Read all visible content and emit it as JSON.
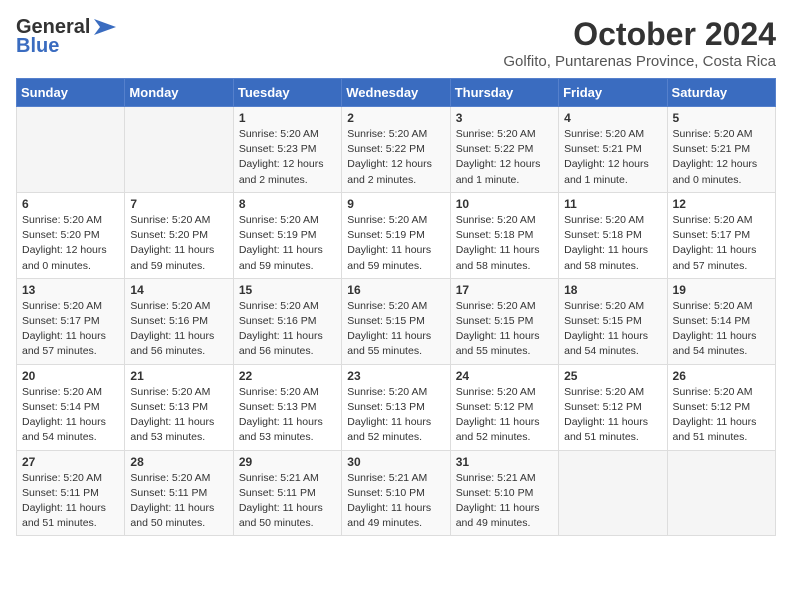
{
  "header": {
    "logo_line1": "General",
    "logo_line2": "Blue",
    "main_title": "October 2024",
    "subtitle": "Golfito, Puntarenas Province, Costa Rica"
  },
  "calendar": {
    "days_of_week": [
      "Sunday",
      "Monday",
      "Tuesday",
      "Wednesday",
      "Thursday",
      "Friday",
      "Saturday"
    ],
    "weeks": [
      [
        {
          "day": "",
          "info": ""
        },
        {
          "day": "",
          "info": ""
        },
        {
          "day": "1",
          "info": "Sunrise: 5:20 AM\nSunset: 5:23 PM\nDaylight: 12 hours\nand 2 minutes."
        },
        {
          "day": "2",
          "info": "Sunrise: 5:20 AM\nSunset: 5:22 PM\nDaylight: 12 hours\nand 2 minutes."
        },
        {
          "day": "3",
          "info": "Sunrise: 5:20 AM\nSunset: 5:22 PM\nDaylight: 12 hours\nand 1 minute."
        },
        {
          "day": "4",
          "info": "Sunrise: 5:20 AM\nSunset: 5:21 PM\nDaylight: 12 hours\nand 1 minute."
        },
        {
          "day": "5",
          "info": "Sunrise: 5:20 AM\nSunset: 5:21 PM\nDaylight: 12 hours\nand 0 minutes."
        }
      ],
      [
        {
          "day": "6",
          "info": "Sunrise: 5:20 AM\nSunset: 5:20 PM\nDaylight: 12 hours\nand 0 minutes."
        },
        {
          "day": "7",
          "info": "Sunrise: 5:20 AM\nSunset: 5:20 PM\nDaylight: 11 hours\nand 59 minutes."
        },
        {
          "day": "8",
          "info": "Sunrise: 5:20 AM\nSunset: 5:19 PM\nDaylight: 11 hours\nand 59 minutes."
        },
        {
          "day": "9",
          "info": "Sunrise: 5:20 AM\nSunset: 5:19 PM\nDaylight: 11 hours\nand 59 minutes."
        },
        {
          "day": "10",
          "info": "Sunrise: 5:20 AM\nSunset: 5:18 PM\nDaylight: 11 hours\nand 58 minutes."
        },
        {
          "day": "11",
          "info": "Sunrise: 5:20 AM\nSunset: 5:18 PM\nDaylight: 11 hours\nand 58 minutes."
        },
        {
          "day": "12",
          "info": "Sunrise: 5:20 AM\nSunset: 5:17 PM\nDaylight: 11 hours\nand 57 minutes."
        }
      ],
      [
        {
          "day": "13",
          "info": "Sunrise: 5:20 AM\nSunset: 5:17 PM\nDaylight: 11 hours\nand 57 minutes."
        },
        {
          "day": "14",
          "info": "Sunrise: 5:20 AM\nSunset: 5:16 PM\nDaylight: 11 hours\nand 56 minutes."
        },
        {
          "day": "15",
          "info": "Sunrise: 5:20 AM\nSunset: 5:16 PM\nDaylight: 11 hours\nand 56 minutes."
        },
        {
          "day": "16",
          "info": "Sunrise: 5:20 AM\nSunset: 5:15 PM\nDaylight: 11 hours\nand 55 minutes."
        },
        {
          "day": "17",
          "info": "Sunrise: 5:20 AM\nSunset: 5:15 PM\nDaylight: 11 hours\nand 55 minutes."
        },
        {
          "day": "18",
          "info": "Sunrise: 5:20 AM\nSunset: 5:15 PM\nDaylight: 11 hours\nand 54 minutes."
        },
        {
          "day": "19",
          "info": "Sunrise: 5:20 AM\nSunset: 5:14 PM\nDaylight: 11 hours\nand 54 minutes."
        }
      ],
      [
        {
          "day": "20",
          "info": "Sunrise: 5:20 AM\nSunset: 5:14 PM\nDaylight: 11 hours\nand 54 minutes."
        },
        {
          "day": "21",
          "info": "Sunrise: 5:20 AM\nSunset: 5:13 PM\nDaylight: 11 hours\nand 53 minutes."
        },
        {
          "day": "22",
          "info": "Sunrise: 5:20 AM\nSunset: 5:13 PM\nDaylight: 11 hours\nand 53 minutes."
        },
        {
          "day": "23",
          "info": "Sunrise: 5:20 AM\nSunset: 5:13 PM\nDaylight: 11 hours\nand 52 minutes."
        },
        {
          "day": "24",
          "info": "Sunrise: 5:20 AM\nSunset: 5:12 PM\nDaylight: 11 hours\nand 52 minutes."
        },
        {
          "day": "25",
          "info": "Sunrise: 5:20 AM\nSunset: 5:12 PM\nDaylight: 11 hours\nand 51 minutes."
        },
        {
          "day": "26",
          "info": "Sunrise: 5:20 AM\nSunset: 5:12 PM\nDaylight: 11 hours\nand 51 minutes."
        }
      ],
      [
        {
          "day": "27",
          "info": "Sunrise: 5:20 AM\nSunset: 5:11 PM\nDaylight: 11 hours\nand 51 minutes."
        },
        {
          "day": "28",
          "info": "Sunrise: 5:20 AM\nSunset: 5:11 PM\nDaylight: 11 hours\nand 50 minutes."
        },
        {
          "day": "29",
          "info": "Sunrise: 5:21 AM\nSunset: 5:11 PM\nDaylight: 11 hours\nand 50 minutes."
        },
        {
          "day": "30",
          "info": "Sunrise: 5:21 AM\nSunset: 5:10 PM\nDaylight: 11 hours\nand 49 minutes."
        },
        {
          "day": "31",
          "info": "Sunrise: 5:21 AM\nSunset: 5:10 PM\nDaylight: 11 hours\nand 49 minutes."
        },
        {
          "day": "",
          "info": ""
        },
        {
          "day": "",
          "info": ""
        }
      ]
    ]
  }
}
